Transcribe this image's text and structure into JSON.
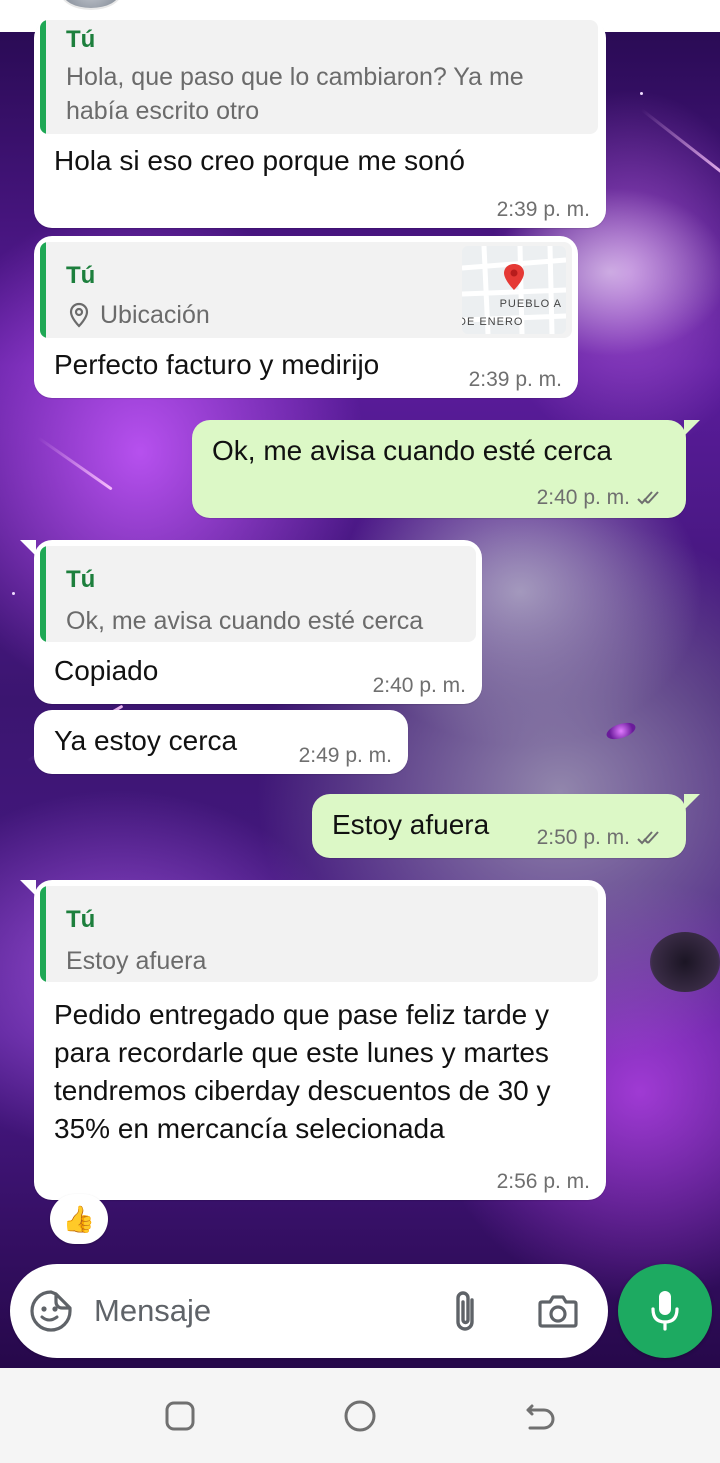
{
  "messages": [
    {
      "direction": "incoming",
      "quote": {
        "author": "Tú",
        "text": "Hola, que paso que lo cambiaron? Ya me había escrito otro"
      },
      "text": "Hola si eso creo porque me sonó",
      "time": "2:39 p. m."
    },
    {
      "direction": "incoming",
      "quote": {
        "author": "Tú",
        "text": "Ubicación",
        "icon": "location-pin-icon",
        "map_label_1": "PUEBLO A",
        "map_label_2": "DE ENERO"
      },
      "text": "Perfecto facturo y medirijo",
      "time": "2:39 p. m."
    },
    {
      "direction": "outgoing",
      "text": "Ok, me avisa cuando esté cerca",
      "time": "2:40 p. m.",
      "status": "read"
    },
    {
      "direction": "incoming",
      "quote": {
        "author": "Tú",
        "text": "Ok, me avisa cuando esté cerca"
      },
      "text": "Copiado",
      "time": "2:40 p. m."
    },
    {
      "direction": "incoming",
      "text": "Ya estoy cerca",
      "time": "2:49 p. m."
    },
    {
      "direction": "outgoing",
      "text": "Estoy afuera",
      "time": "2:50 p. m.",
      "status": "read"
    },
    {
      "direction": "incoming",
      "quote": {
        "author": "Tú",
        "text": "Estoy afuera"
      },
      "text": "Pedido entregado que pase feliz tarde y para recordarle que este lunes y martes tendremos ciberday descuentos de 30 y 35% en mercancía selecionada",
      "time": "2:56 p. m.",
      "reaction": "👍"
    }
  ],
  "composer": {
    "placeholder": "Mensaje",
    "emoji_icon": "sticker-emoji-icon",
    "attach_icon": "paperclip-icon",
    "camera_icon": "camera-icon",
    "mic_icon": "microphone-icon"
  },
  "nav": {
    "recents_icon": "recents-square-icon",
    "home_icon": "home-circle-icon",
    "back_icon": "back-arrow-icon"
  },
  "colors": {
    "incoming_bubble": "#ffffff",
    "outgoing_bubble": "#dcf8c6",
    "quote_bar": "#1fa855",
    "quote_author": "#1d7f3d",
    "mic_button": "#1daa61",
    "read_ticks": "#53bdeb"
  }
}
